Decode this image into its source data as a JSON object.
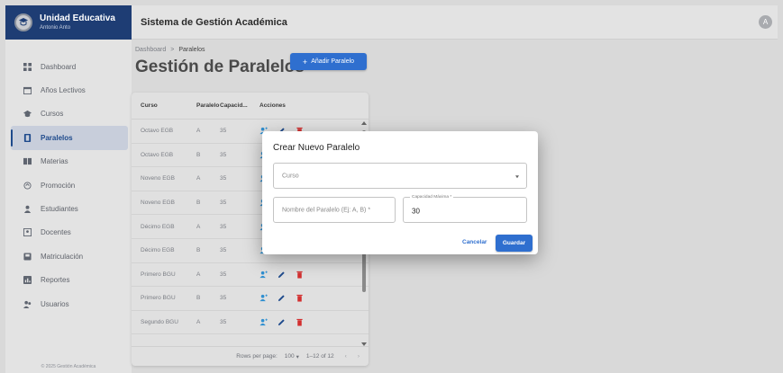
{
  "app": {
    "school_name": "Unidad Educativa",
    "user_name": "Antonio Anto",
    "system_title": "Sistema de Gestión Académica",
    "avatar_initial": "A",
    "footer": "© 2025 Gestión Académica"
  },
  "sidebar": {
    "items": [
      {
        "label": "Dashboard",
        "icon": "dashboard-icon"
      },
      {
        "label": "Años Lectivos",
        "icon": "calendar-icon"
      },
      {
        "label": "Cursos",
        "icon": "school-icon"
      },
      {
        "label": "Paralelos",
        "icon": "class-icon",
        "active": true
      },
      {
        "label": "Materias",
        "icon": "book-icon"
      },
      {
        "label": "Promoción",
        "icon": "promotion-icon"
      },
      {
        "label": "Estudiantes",
        "icon": "student-icon"
      },
      {
        "label": "Docentes",
        "icon": "teacher-icon"
      },
      {
        "label": "Matriculación",
        "icon": "enroll-icon"
      },
      {
        "label": "Reportes",
        "icon": "report-icon"
      },
      {
        "label": "Usuarios",
        "icon": "users-icon"
      }
    ]
  },
  "main": {
    "breadcrumb": {
      "root": "Dashboard",
      "separator": ">",
      "current": "Paralelos"
    },
    "title": "Gestión de Paralelos",
    "add_button": "Añadir Paralelo"
  },
  "table": {
    "columns": [
      "Curso",
      "Paralelo",
      "Capacid...",
      "Acciones"
    ],
    "rows": [
      {
        "curso": "Octavo EGB",
        "paralelo": "A",
        "capacidad": "35"
      },
      {
        "curso": "Octavo EGB",
        "paralelo": "B",
        "capacidad": "35"
      },
      {
        "curso": "Noveno EGB",
        "paralelo": "A",
        "capacidad": "35"
      },
      {
        "curso": "Noveno EGB",
        "paralelo": "B",
        "capacidad": "35"
      },
      {
        "curso": "Décimo EGB",
        "paralelo": "A",
        "capacidad": "35"
      },
      {
        "curso": "Décimo EGB",
        "paralelo": "B",
        "capacidad": "35"
      },
      {
        "curso": "Primero BGU",
        "paralelo": "A",
        "capacidad": "35"
      },
      {
        "curso": "Primero BGU",
        "paralelo": "B",
        "capacidad": "35"
      },
      {
        "curso": "Segundo BGU",
        "paralelo": "A",
        "capacidad": "35"
      }
    ],
    "footer": {
      "rows_per_page_label": "Rows per page:",
      "rows_per_page": "100",
      "range": "1–12 of 12"
    }
  },
  "modal": {
    "title": "Crear Nuevo Paralelo",
    "curso_placeholder": "Curso",
    "nombre_placeholder": "Nombre del Paralelo (Ej: A, B) *",
    "capacidad_label": "Capacidad Máxima *",
    "capacidad_value": "30",
    "cancel": "Cancelar",
    "save": "Guardar"
  },
  "colors": {
    "brand": "#1e3d74",
    "primary": "#2f6fcf",
    "add_student_action": "#2f8fd0",
    "edit_action": "#1e4a8c",
    "delete_action": "#d32f2f"
  }
}
